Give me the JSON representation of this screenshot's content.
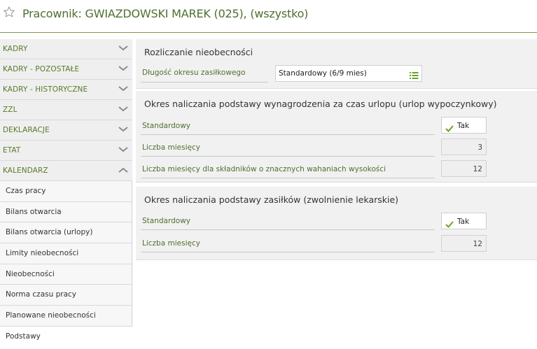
{
  "header": {
    "title": "Pracownik: GWIAZDOWSKI MAREK (025), (wszystko)"
  },
  "sidebar": {
    "groups": [
      {
        "label": "KADRY"
      },
      {
        "label": "KADRY - POZOSTAŁE"
      },
      {
        "label": "KADRY - HISTORYCZNE"
      },
      {
        "label": "ZZL"
      },
      {
        "label": "DEKLARACJE"
      },
      {
        "label": "ETAT"
      },
      {
        "label": "KALENDARZ"
      }
    ],
    "subitems": [
      {
        "label": "Czas pracy"
      },
      {
        "label": "Bilans otwarcia"
      },
      {
        "label": "Bilans otwarcia (urlopy)"
      },
      {
        "label": "Limity nieobecności"
      },
      {
        "label": "Nieobecności"
      },
      {
        "label": "Norma czasu pracy"
      },
      {
        "label": "Planowane nieobecności"
      },
      {
        "label": "Podstawy"
      }
    ]
  },
  "section1": {
    "title": "Rozliczanie nieobecności",
    "label": "Długość okresu zasiłkowego",
    "value": "Standardowy (6/9 mies)"
  },
  "section2": {
    "title": "Okres naliczania podstawy wynagrodzenia za czas urlopu (urlop wypoczynkowy)",
    "standard_label": "Standardowy",
    "standard_value": "Tak",
    "months_label": "Liczba miesięcy",
    "months_value": "3",
    "months_var_label": "Liczba miesięcy dla składników o znacznych wahaniach wysokości",
    "months_var_value": "12"
  },
  "section3": {
    "title": "Okres naliczania podstawy zasiłków (zwolnienie lekarskie)",
    "standard_label": "Standardowy",
    "standard_value": "Tak",
    "months_label": "Liczba miesięcy",
    "months_value": "12"
  }
}
